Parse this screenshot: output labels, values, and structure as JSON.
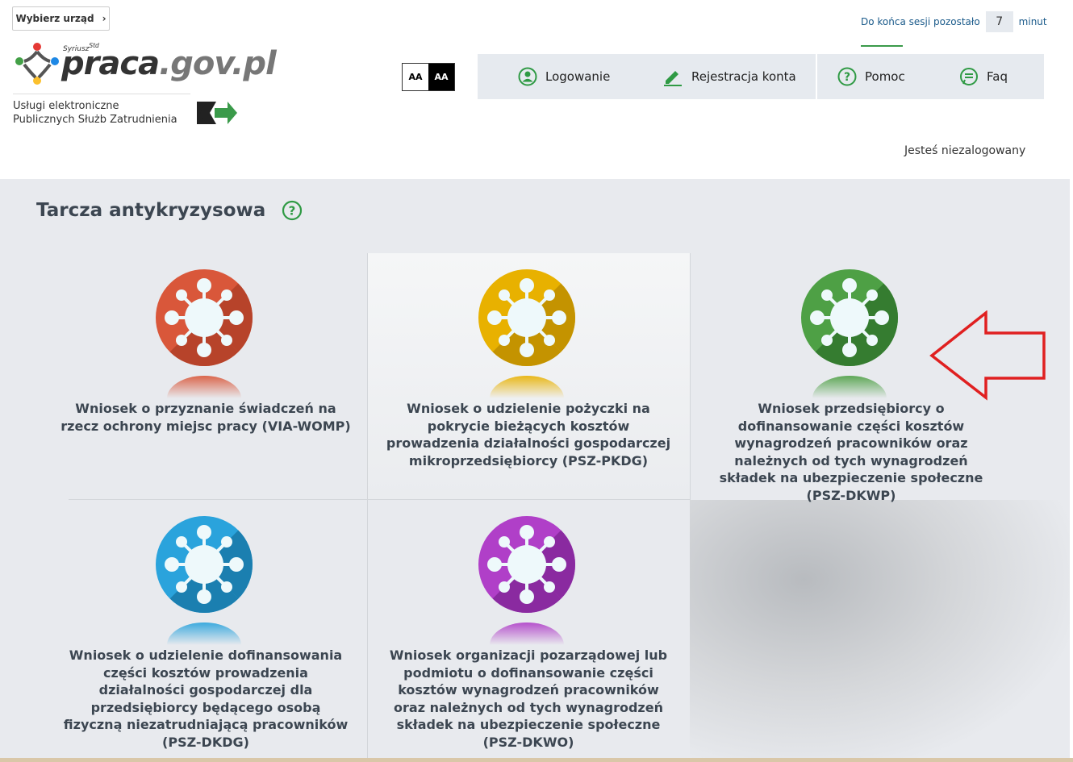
{
  "header": {
    "office_button": "Wybierz urząd",
    "logo_super": "Syriusz",
    "logo_super_std": "Std",
    "logo_praca": "praca",
    "logo_gov": ".gov.pl",
    "logo_caption_1": "Usługi elektroniczne",
    "logo_caption_2": "Publicznych Służb Zatrudnienia",
    "contrast_light": "AA",
    "contrast_dark": "AA",
    "session_label": "Do końca sesji pozostało",
    "session_value": "7",
    "session_unit": "minut",
    "status": "Jesteś niezalogowany"
  },
  "menu": [
    {
      "label": "Logowanie",
      "icon": "user-icon"
    },
    {
      "label": "Rejestracja konta",
      "icon": "pencil-icon"
    },
    {
      "label": "Pomoc",
      "icon": "help-icon"
    },
    {
      "label": "Faq",
      "icon": "chat-icon"
    }
  ],
  "main": {
    "title": "Tarcza antykryzysowa",
    "tiles": [
      {
        "label": "Wniosek o przyznanie świadczeń na rzecz ochrony miejsc pracy (VIA-WOMP)",
        "color": "#d9573a",
        "shadow": "#b7432a",
        "glow": "#d9573a"
      },
      {
        "label": "Wniosek o udzielenie pożyczki na pokrycie bieżących kosztów prowadzenia działalności gospodarczej mikroprzedsiębiorcy (PSZ-PKDG)",
        "color": "#e8b100",
        "shadow": "#c49300",
        "glow": "#e8b100"
      },
      {
        "label": "Wniosek przedsiębiorcy o dofinansowanie części kosztów wynagrodzeń pracowników oraz należnych od tych wynagrodzeń składek na ubezpieczenie społeczne (PSZ-DKWP)",
        "color": "#4ea045",
        "shadow": "#357c30",
        "glow": "#4ea045"
      },
      {
        "label": "Wniosek o udzielenie dofinansowania części kosztów prowadzenia działalności gospodarczej dla przedsiębiorcy będącego osobą fizyczną niezatrudniającą pracowników (PSZ-DKDG)",
        "color": "#2aa3dc",
        "shadow": "#1b7fb0",
        "glow": "#2aa3dc"
      },
      {
        "label": "Wniosek organizacji pozarządowej lub podmiotu o dofinansowanie części kosztów wynagrodzeń pracowników oraz należnych od tych wynagrodzeń składek na ubezpieczenie społeczne (PSZ-DKWO)",
        "color": "#b03fc8",
        "shadow": "#8a2aa0",
        "glow": "#b03fc8"
      }
    ]
  }
}
